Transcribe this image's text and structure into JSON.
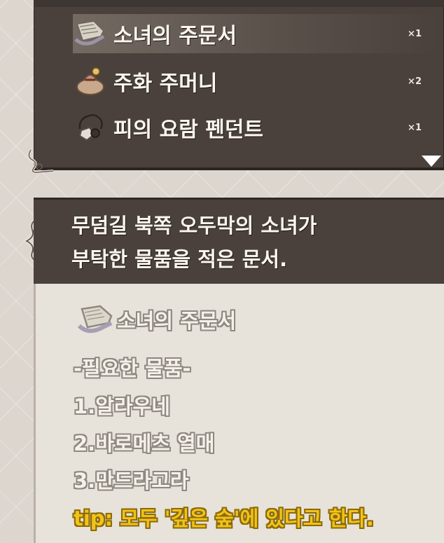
{
  "inventory": {
    "items": [
      {
        "name": "소녀의 주문서",
        "count": "×1",
        "icon": "scroll-icon",
        "selected": true
      },
      {
        "name": "주화 주머니",
        "count": "×2",
        "icon": "coin-pouch-icon",
        "selected": false
      },
      {
        "name": "피의 요람 펜던트",
        "count": "×1",
        "icon": "pendant-icon",
        "selected": false
      }
    ]
  },
  "description": {
    "line1": "무덤길 북쪽 오두막의 소녀가",
    "line2": "부탁한 물품을 적은 문서."
  },
  "detail": {
    "title": "소녀의 주문서",
    "heading": "-필요한 물품-",
    "lines": [
      "1.알라우네",
      "2.바로메츠 열매",
      "3.만드라고라"
    ],
    "tip": "tip: 모두 '깊은 숲'에 있다고 한다."
  },
  "colors": {
    "panel_dark": "#4a413c",
    "panel_light": "#e7e2da",
    "tip_yellow": "#f2c21a"
  }
}
